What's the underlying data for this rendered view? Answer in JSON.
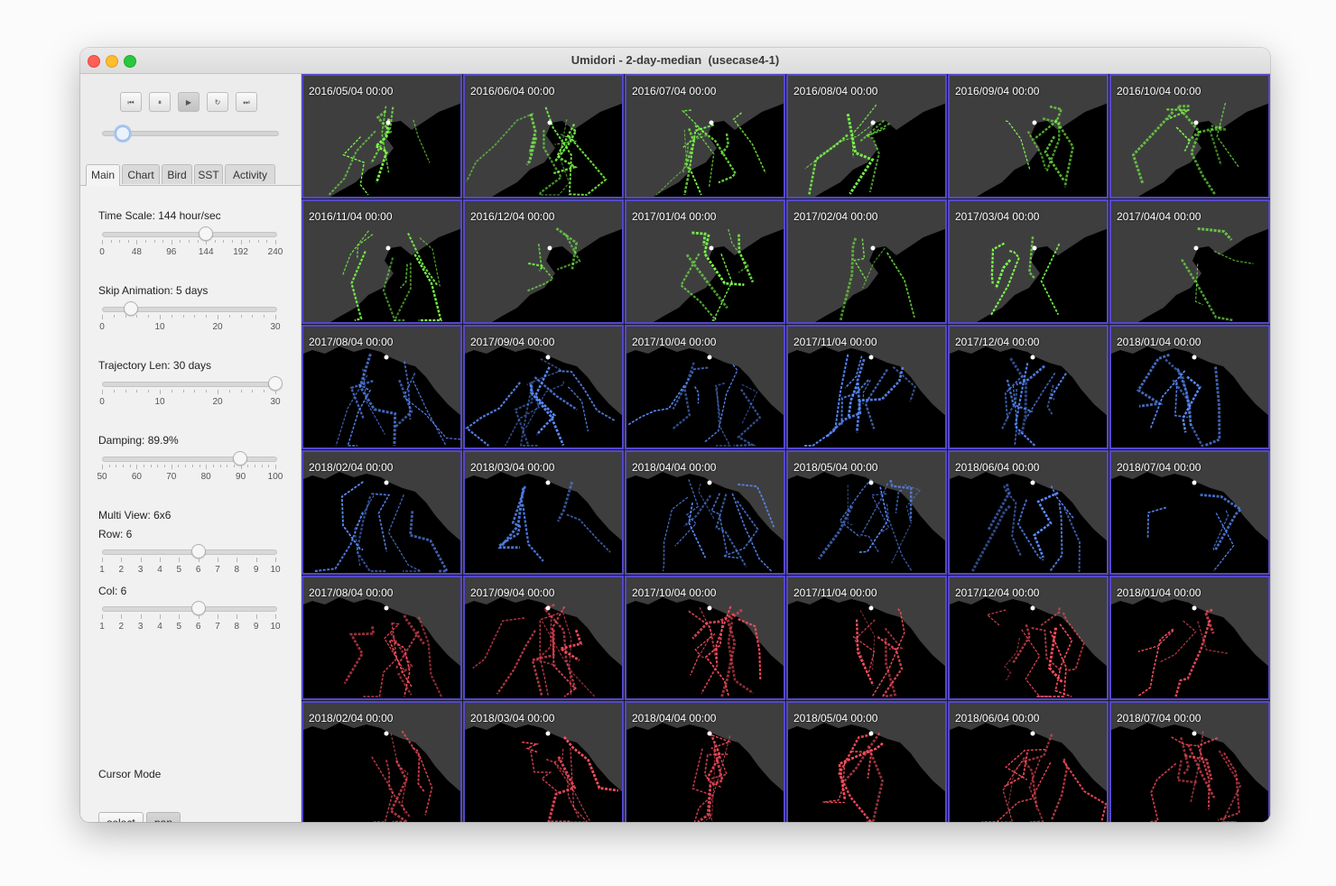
{
  "window": {
    "title": "Umidori - 2-day-median  (usecase4-1)"
  },
  "playback": {
    "buttons": [
      {
        "name": "skip-back-button",
        "glyph": "⏮"
      },
      {
        "name": "pause-button",
        "glyph": "⏸"
      },
      {
        "name": "play-button",
        "glyph": "▶"
      },
      {
        "name": "reload-button",
        "glyph": "↻"
      },
      {
        "name": "skip-forward-button",
        "glyph": "⏭"
      }
    ],
    "active": "play-button",
    "progress": 0.12
  },
  "tabs": [
    {
      "label": "Main",
      "active": true
    },
    {
      "label": "Chart",
      "active": false
    },
    {
      "label": "Bird",
      "active": false
    },
    {
      "label": "SST",
      "active": false
    },
    {
      "label": "Activity",
      "active": false
    }
  ],
  "controls": {
    "time_scale": {
      "label": "Time Scale: 144 hour/sec",
      "value": 144,
      "min": 0,
      "max": 240,
      "ticks": [
        "0",
        "48",
        "96",
        "144",
        "192",
        "240"
      ]
    },
    "skip_animation": {
      "label": "Skip Animation: 5 days",
      "value": 5,
      "min": 0,
      "max": 30,
      "ticks": [
        "0",
        "10",
        "20",
        "30"
      ]
    },
    "trajectory_len": {
      "label": "Trajectory Len: 30 days",
      "value": 30,
      "min": 0,
      "max": 30,
      "ticks": [
        "0",
        "10",
        "20",
        "30"
      ]
    },
    "damping": {
      "label": "Damping: 89.9%",
      "value": 89.9,
      "min": 50,
      "max": 100,
      "ticks": [
        "50",
        "60",
        "70",
        "80",
        "90",
        "100"
      ]
    },
    "multi_view_label": "Multi View: 6x6",
    "row": {
      "label": "Row: 6",
      "value": 6,
      "min": 1,
      "max": 10,
      "ticks": [
        "1",
        "2",
        "3",
        "4",
        "5",
        "6",
        "7",
        "8",
        "9",
        "10"
      ]
    },
    "col": {
      "label": "Col: 6",
      "value": 6,
      "min": 1,
      "max": 10,
      "ticks": [
        "1",
        "2",
        "3",
        "4",
        "5",
        "6",
        "7",
        "8",
        "9",
        "10"
      ]
    },
    "cursor_mode_label": "Cursor Mode",
    "cursor_buttons": [
      {
        "label": "select",
        "active": false
      },
      {
        "label": "pan",
        "active": true
      }
    ]
  },
  "colors": {
    "cell_border": "#5548c8",
    "green": "#7cff4a",
    "blue": "#5a8cff",
    "red": "#ff5060"
  },
  "panels": [
    {
      "label": "2016/05/04 00:00",
      "map": "japan",
      "color": "green"
    },
    {
      "label": "2016/06/04 00:00",
      "map": "japan",
      "color": "green"
    },
    {
      "label": "2016/07/04 00:00",
      "map": "japan",
      "color": "green"
    },
    {
      "label": "2016/08/04 00:00",
      "map": "japan",
      "color": "green"
    },
    {
      "label": "2016/09/04 00:00",
      "map": "japan",
      "color": "green"
    },
    {
      "label": "2016/10/04 00:00",
      "map": "japan",
      "color": "green"
    },
    {
      "label": "2016/11/04 00:00",
      "map": "japan",
      "color": "green"
    },
    {
      "label": "2016/12/04 00:00",
      "map": "japan",
      "color": "green"
    },
    {
      "label": "2017/01/04 00:00",
      "map": "japan",
      "color": "green"
    },
    {
      "label": "2017/02/04 00:00",
      "map": "japan",
      "color": "green"
    },
    {
      "label": "2017/03/04 00:00",
      "map": "japan",
      "color": "green"
    },
    {
      "label": "2017/04/04 00:00",
      "map": "japan",
      "color": "green"
    },
    {
      "label": "2017/08/04 00:00",
      "map": "coast",
      "color": "blue"
    },
    {
      "label": "2017/09/04 00:00",
      "map": "coast",
      "color": "blue"
    },
    {
      "label": "2017/10/04 00:00",
      "map": "coast",
      "color": "blue"
    },
    {
      "label": "2017/11/04 00:00",
      "map": "coast",
      "color": "blue"
    },
    {
      "label": "2017/12/04 00:00",
      "map": "coast",
      "color": "blue"
    },
    {
      "label": "2018/01/04 00:00",
      "map": "coast",
      "color": "blue"
    },
    {
      "label": "2018/02/04 00:00",
      "map": "coast",
      "color": "blue"
    },
    {
      "label": "2018/03/04 00:00",
      "map": "coast",
      "color": "blue"
    },
    {
      "label": "2018/04/04 00:00",
      "map": "coast",
      "color": "blue"
    },
    {
      "label": "2018/05/04 00:00",
      "map": "coast",
      "color": "blue"
    },
    {
      "label": "2018/06/04 00:00",
      "map": "coast",
      "color": "blue"
    },
    {
      "label": "2018/07/04 00:00",
      "map": "coast",
      "color": "blue"
    },
    {
      "label": "2017/08/04 00:00",
      "map": "coast",
      "color": "red"
    },
    {
      "label": "2017/09/04 00:00",
      "map": "coast",
      "color": "red"
    },
    {
      "label": "2017/10/04 00:00",
      "map": "coast",
      "color": "red"
    },
    {
      "label": "2017/11/04 00:00",
      "map": "coast",
      "color": "red"
    },
    {
      "label": "2017/12/04 00:00",
      "map": "coast",
      "color": "red"
    },
    {
      "label": "2018/01/04 00:00",
      "map": "coast",
      "color": "red"
    },
    {
      "label": "2018/02/04 00:00",
      "map": "coast",
      "color": "red"
    },
    {
      "label": "2018/03/04 00:00",
      "map": "coast",
      "color": "red"
    },
    {
      "label": "2018/04/04 00:00",
      "map": "coast",
      "color": "red"
    },
    {
      "label": "2018/05/04 00:00",
      "map": "coast",
      "color": "red"
    },
    {
      "label": "2018/06/04 00:00",
      "map": "coast",
      "color": "red"
    },
    {
      "label": "2018/07/04 00:00",
      "map": "coast",
      "color": "red"
    }
  ]
}
